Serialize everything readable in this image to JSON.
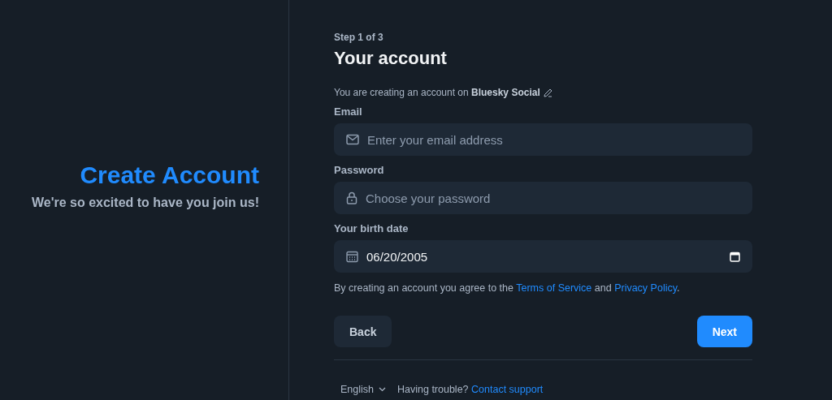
{
  "intro": {
    "title": "Create Account",
    "subtitle": "We're so excited to have you join us!"
  },
  "step": "Step 1 of 3",
  "heading": "Your account",
  "hosting": {
    "text": "You are creating an account on",
    "provider": "Bluesky Social"
  },
  "fields": [
    {
      "kind": "email",
      "label": "Email",
      "placeholder": "Enter your email address"
    },
    {
      "kind": "password",
      "label": "Password",
      "placeholder": "Choose your password"
    },
    {
      "kind": "date",
      "label": "Your birth date",
      "value": "06/20/2005"
    }
  ],
  "terms": {
    "before": "By creating an account you agree to the",
    "link1": "Terms of Service",
    "middle": "and",
    "link2": "Privacy Policy",
    "after": "."
  },
  "buttons": {
    "back": "Back",
    "next": "Next"
  },
  "footer": {
    "language": "English",
    "trouble": "Having trouble?",
    "support": "Contact support"
  }
}
